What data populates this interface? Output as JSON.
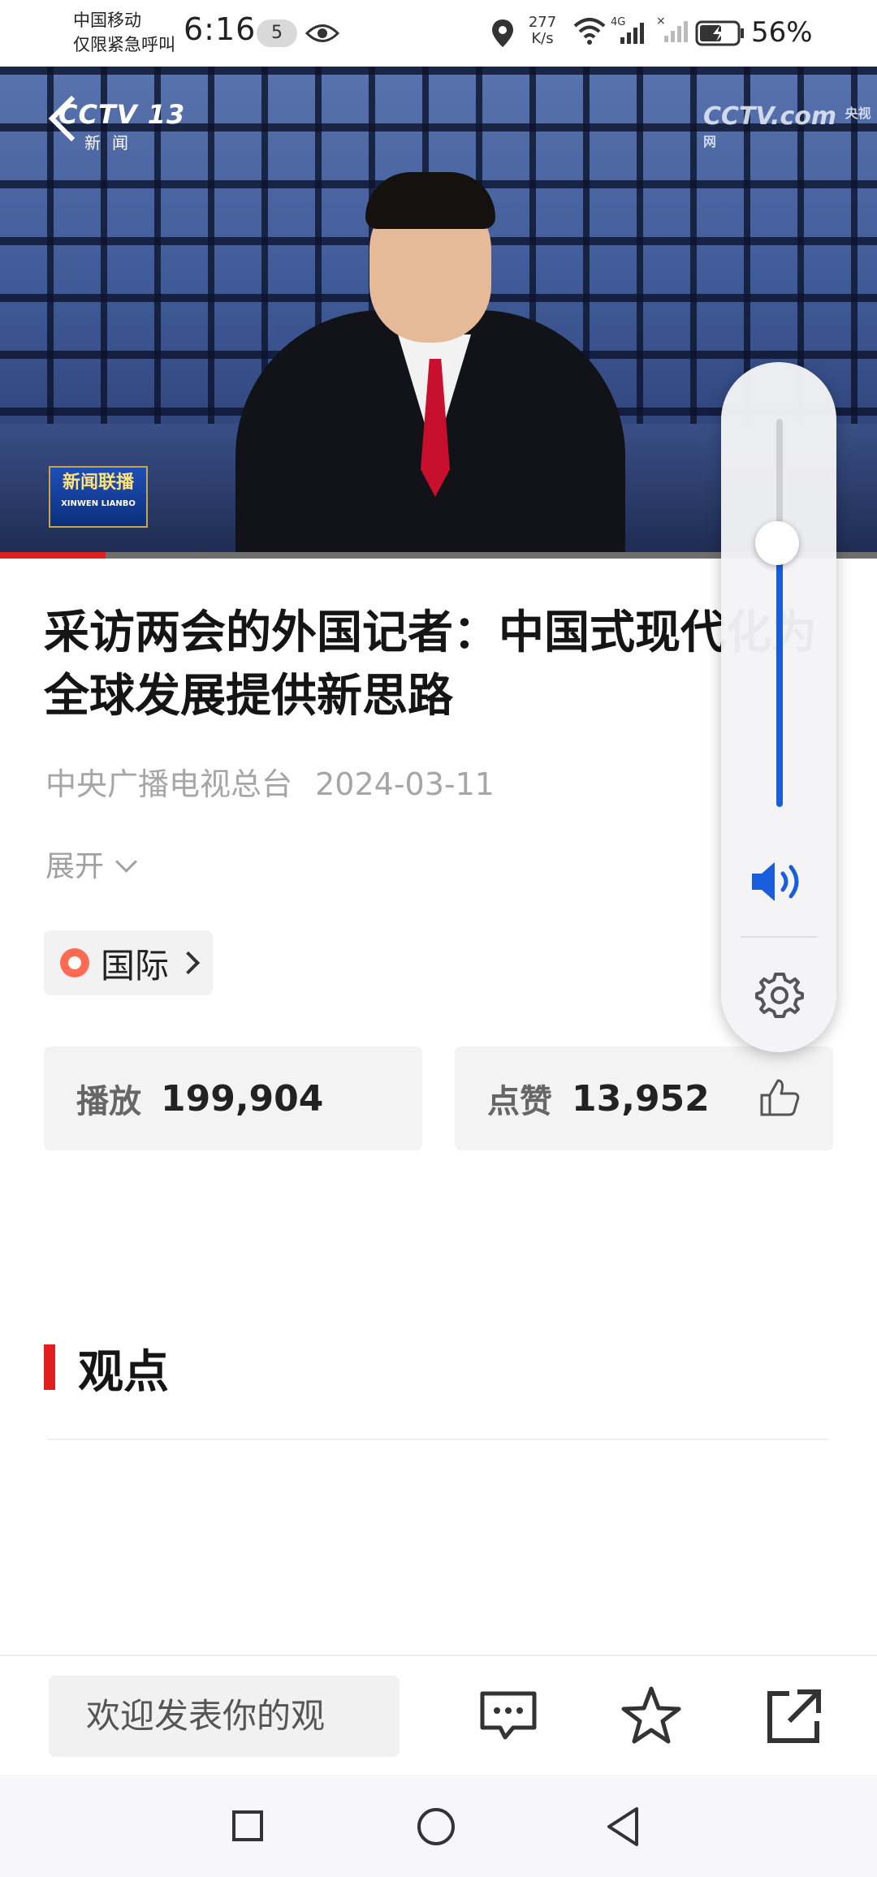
{
  "status_bar": {
    "carrier_line1": "中国移动",
    "carrier_line2": "仅限紧急呼叫",
    "time": "6:16",
    "notification_count": "5",
    "net_speed_value": "277",
    "net_speed_unit": "K/s",
    "signal_label": "4G",
    "battery_percent": "56%"
  },
  "video": {
    "channel_logo": "CCTV 13",
    "channel_sub": "新闻",
    "watermark": "CCTV.com",
    "watermark_sub": "央视网",
    "program_logo": "新闻联播",
    "program_logo_sub": "XINWEN LIANBO",
    "progress": 0.12
  },
  "article": {
    "title": "采访两会的外国记者：中国式现代化为全球发展提供新思路",
    "source": "中央广播电视总台",
    "date": "2024-03-11",
    "expand_label": "展开",
    "tag_label": "国际",
    "plays_label": "播放",
    "plays_value": "199,904",
    "likes_label": "点赞",
    "likes_value": "13,952",
    "section_title": "观点"
  },
  "volume_panel": {
    "level": 0.68,
    "accent_color": "#1a5ddc",
    "speaker_icon": "speaker-icon",
    "settings_icon": "gear-icon"
  },
  "bottom_bar": {
    "comment_placeholder": "欢迎发表你的观",
    "icons": [
      "comment-icon",
      "star-icon",
      "share-icon"
    ]
  },
  "colors": {
    "brand_red": "#e02020",
    "tag_dot": "#ff6a52"
  }
}
